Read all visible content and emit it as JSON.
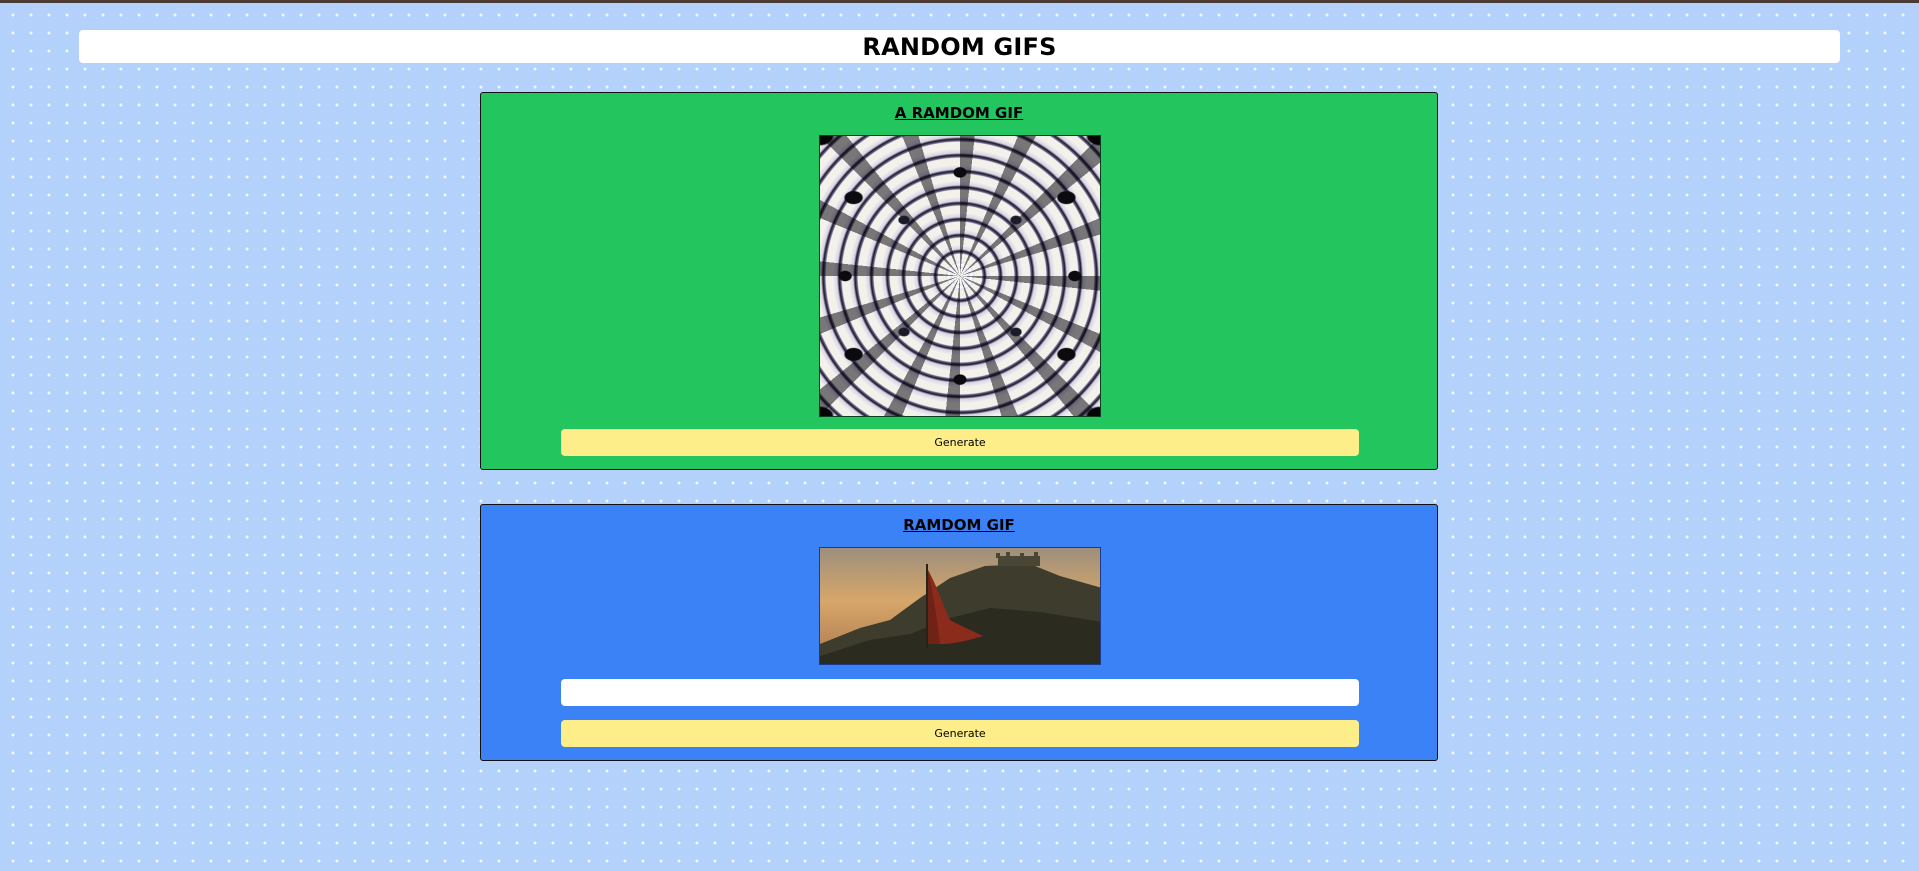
{
  "page": {
    "title": "RANDOM GIFS"
  },
  "random_card": {
    "title": "A RAMDOM GIF",
    "image_alt": "kaleidoscope-swirl-gif",
    "generate_label": "Generate",
    "background": "#22c55e"
  },
  "tag_card": {
    "title": "RAMDOM GIF",
    "image_alt": "fortress-flag-gif",
    "tag_input_value": "",
    "tag_input_placeholder": "",
    "generate_label": "Generate",
    "background": "#3b82f6"
  },
  "colors": {
    "page_background": "#b3d1fb",
    "button_background": "#fdee8a",
    "header_background": "#ffffff"
  }
}
